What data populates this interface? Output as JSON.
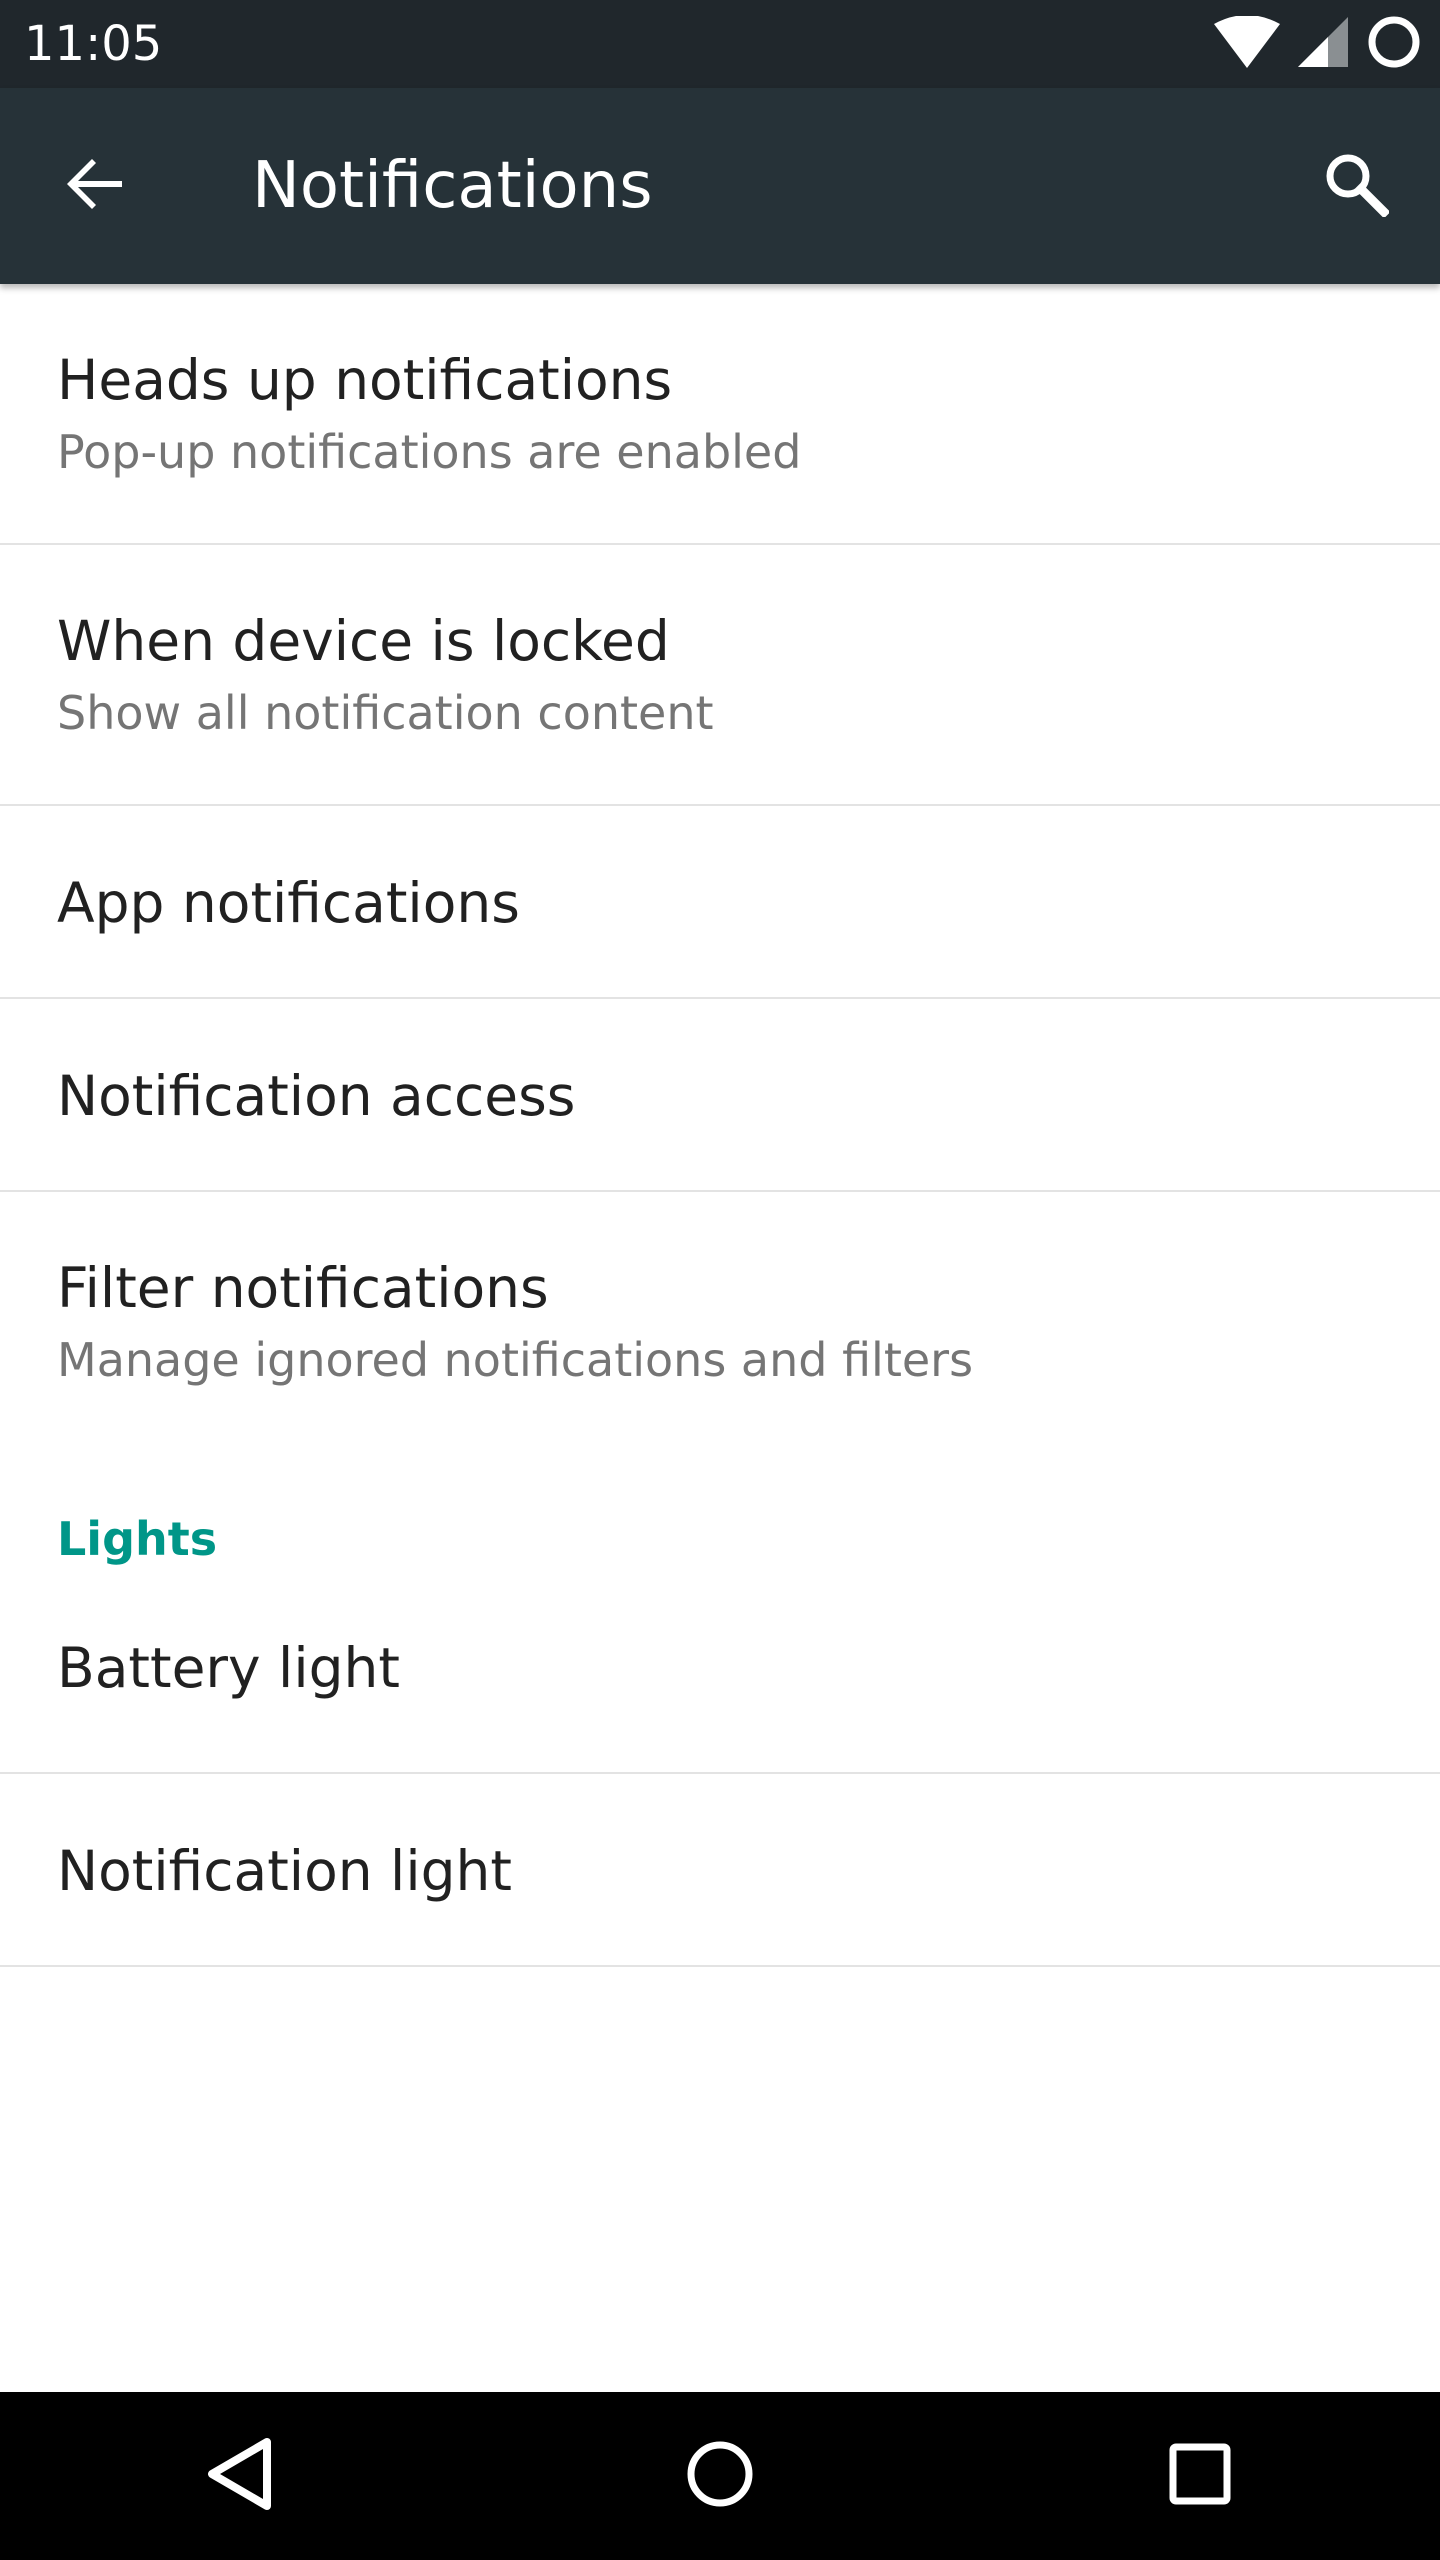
{
  "status_bar": {
    "time": "11:05",
    "icons": [
      "wifi-icon",
      "cell-signal-icon",
      "sync-icon"
    ]
  },
  "app_bar": {
    "title": "Notifications",
    "back_icon": "arrow-back-icon",
    "search_icon": "search-icon"
  },
  "settings": {
    "heads_up": {
      "title": "Heads up notifications",
      "summary": "Pop-up notifications are enabled"
    },
    "device_locked": {
      "title": "When device is locked",
      "summary": "Show all notification content"
    },
    "app_notifications": {
      "title": "App notifications"
    },
    "notification_access": {
      "title": "Notification access"
    },
    "filter_notifications": {
      "title": "Filter notifications",
      "summary": "Manage ignored notifications and filters"
    },
    "lights_category": {
      "label": "Lights"
    },
    "battery_light": {
      "title": "Battery light"
    },
    "notification_light": {
      "title": "Notification light"
    }
  },
  "nav_bar": {
    "icons": [
      "back-triangle-icon",
      "home-circle-icon",
      "recents-square-icon"
    ]
  },
  "colors": {
    "status_bar": "#20272c",
    "app_bar": "#263238",
    "accent": "#009688",
    "primary_text": "#212121",
    "secondary_text": "#757575",
    "divider": "#e3e3e3"
  }
}
